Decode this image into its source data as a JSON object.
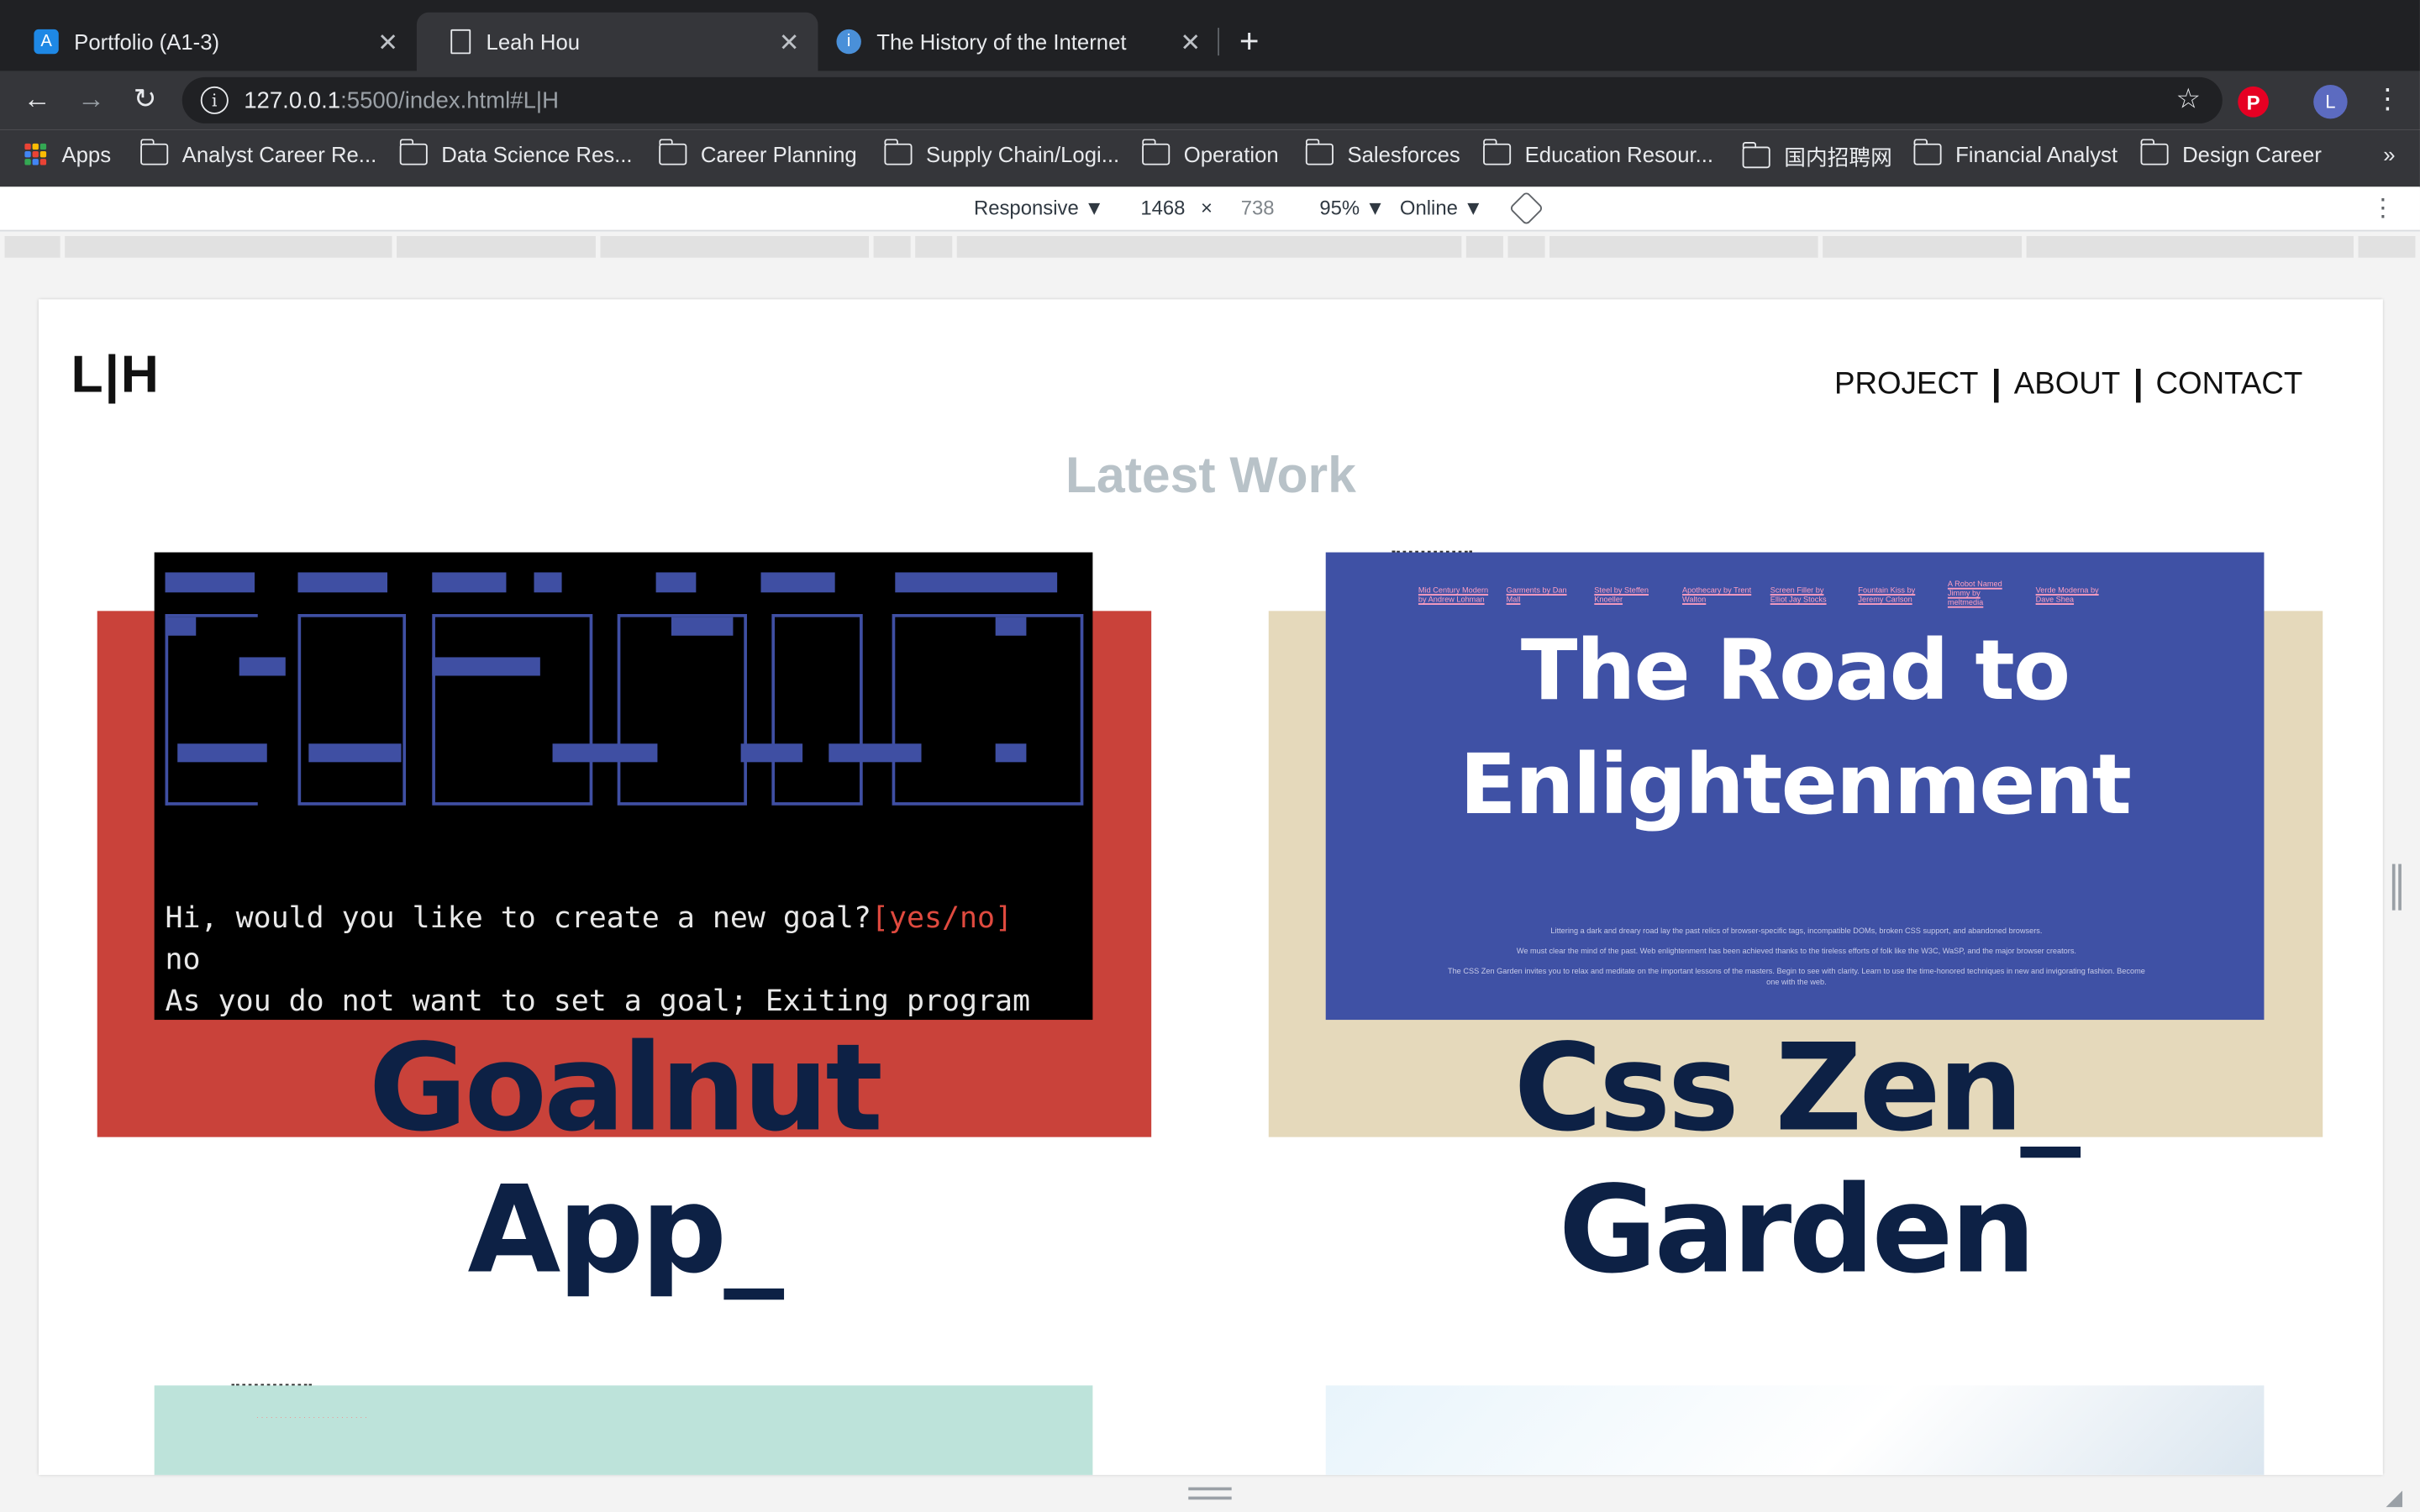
{
  "browser": {
    "tabs": [
      {
        "title": "Portfolio (A1-3)",
        "active": false,
        "icon": "app-icon"
      },
      {
        "title": "Leah Hou",
        "active": true,
        "icon": "page-icon"
      },
      {
        "title": "The History of the Internet",
        "active": false,
        "icon": "globe-icon"
      }
    ],
    "url": {
      "host": "127.0.0.1",
      "rest": ":5500/index.html#L|H"
    },
    "avatar_letter": "L",
    "bookmarks": {
      "apps_label": "Apps",
      "items": [
        "Analyst Career Re...",
        "Data Science Res...",
        "Career Planning",
        "Supply Chain/Logi...",
        "Operation",
        "Salesforces",
        "Education Resour...",
        "国内招聘网",
        "Financial Analyst",
        "Design Career"
      ],
      "more": "»"
    }
  },
  "devtools": {
    "device": "Responsive ▼",
    "width": "1468",
    "times": "×",
    "height": "738",
    "zoom": "95% ▼",
    "network": "Online ▼"
  },
  "page": {
    "logo": "L|H",
    "nav": [
      "PROJECT",
      "ABOUT",
      "CONTACT"
    ],
    "section_title": "Latest Work",
    "projects": [
      {
        "title_line1": "Goalnut",
        "title_line2": "App_",
        "bg_color": "#c9423a",
        "terminal": {
          "prompt": "Hi, would you like to create a new goal?",
          "prompt_option": "[yes/no]",
          "answer": "no",
          "exit": "As you do not want to set a goal; Exiting program"
        }
      },
      {
        "title_line1": "Css Zen_",
        "title_line2": "Garden",
        "bg_color": "#e5d9bb",
        "zen": {
          "title": "The Road to Enlightenment",
          "links": [
            "Mid Century Modern by Andrew Lohman",
            "Garments by Dan Mall",
            "Steel by Steffen Knoeller",
            "Apothecary by Trent Walton",
            "Screen Filler by Elliot Jay Stocks",
            "Fountain Kiss by Jeremy Carlson",
            "A Robot Named Jimmy by meltmedia",
            "Verde Moderna by Dave Shea"
          ],
          "paragraphs": [
            "Littering a dark and dreary road lay the past relics of browser-specific tags, incompatible DOMs, broken CSS support, and abandoned browsers.",
            "We must clear the mind of the past. Web enlightenment has been achieved thanks to the tireless efforts of folk like the W3C, WaSP, and the major browser creators.",
            "The CSS Zen Garden invites you to relax and meditate on the important lessons of the masters. Begin to see with clarity. Learn to use the time-honored techniques in new and invigorating fashion. Become one with the web."
          ]
        }
      }
    ]
  }
}
